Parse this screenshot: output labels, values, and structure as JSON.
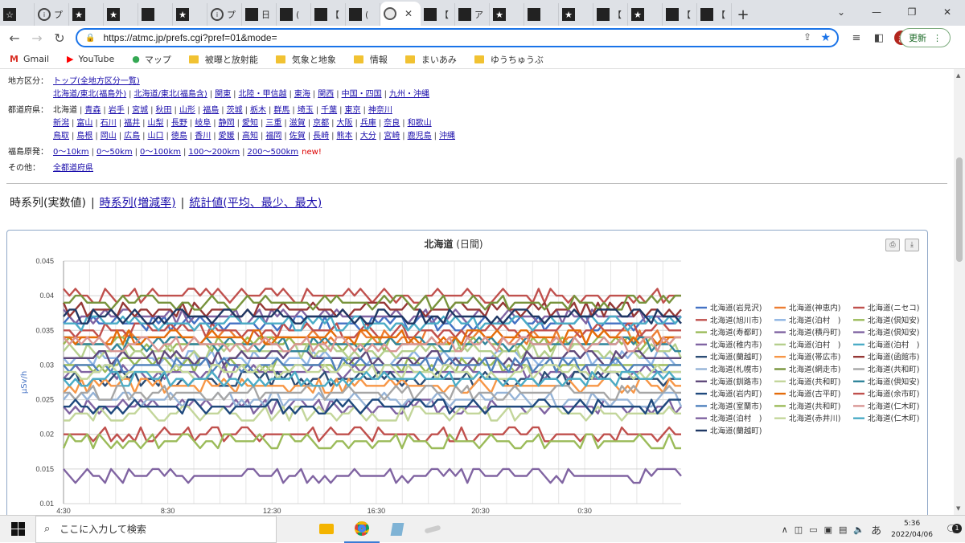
{
  "browser": {
    "tabs": [
      {
        "title": "",
        "icon": "clip-icon",
        "glyph": "☆",
        "fav": "blk"
      },
      {
        "title": "プ",
        "icon": "info-icon",
        "glyph": "i",
        "fav": "ring"
      },
      {
        "title": "",
        "icon": "clip-icon",
        "glyph": "★",
        "fav": "blk"
      },
      {
        "title": "",
        "icon": "clip-icon",
        "glyph": "★",
        "fav": "blk"
      },
      {
        "title": "",
        "icon": "clip-icon",
        "glyph": "",
        "fav": "blk"
      },
      {
        "title": "",
        "icon": "clip-icon",
        "glyph": "★",
        "fav": "blk"
      },
      {
        "title": "プ",
        "icon": "info-icon",
        "glyph": "i",
        "fav": "ring"
      },
      {
        "title": "日",
        "icon": "clip-icon",
        "glyph": "",
        "fav": "blk"
      },
      {
        "title": "(",
        "icon": "clip-icon",
        "glyph": "",
        "fav": "blk"
      },
      {
        "title": "【",
        "icon": "clip-icon",
        "glyph": "",
        "fav": "blk"
      },
      {
        "title": "(",
        "icon": "clip-icon",
        "glyph": "",
        "fav": "blk"
      }
    ],
    "active_tab": {
      "icon": "globe-icon",
      "close": "✕"
    },
    "tabs_after": [
      {
        "title": "【",
        "icon": "clip-icon",
        "glyph": "",
        "fav": "blk"
      },
      {
        "title": "ア",
        "icon": "clip-icon",
        "glyph": "",
        "fav": "blk"
      },
      {
        "title": "",
        "icon": "clip-icon",
        "glyph": "★",
        "fav": "blk"
      },
      {
        "title": "",
        "icon": "clip-icon",
        "glyph": "",
        "fav": "blk"
      },
      {
        "title": "",
        "icon": "clip-icon",
        "glyph": "★",
        "fav": "blk"
      },
      {
        "title": "【",
        "icon": "clip-icon",
        "glyph": "",
        "fav": "blk"
      },
      {
        "title": "",
        "icon": "clip-icon",
        "glyph": "★",
        "fav": "blk"
      },
      {
        "title": "【",
        "icon": "clip-icon",
        "glyph": "",
        "fav": "blk"
      },
      {
        "title": "【",
        "icon": "clip-icon",
        "glyph": "",
        "fav": "blk"
      }
    ],
    "new_tab": "+",
    "url": "https://atmc.jp/prefs.cgi?pref=01&mode=",
    "update_label": "更新",
    "avatar_letter": "ま",
    "bookmarks": [
      {
        "label": "Gmail",
        "icon": "gmail-icon",
        "glyph": "M",
        "color": "#d93025"
      },
      {
        "label": "YouTube",
        "icon": "youtube-icon",
        "glyph": "▶",
        "color": "#ff0000"
      },
      {
        "label": "マップ",
        "icon": "maps-icon",
        "glyph": "●",
        "color": "#34a853"
      },
      {
        "label": "被曝と放射能",
        "icon": "folder-icon"
      },
      {
        "label": "気象と地象",
        "icon": "folder-icon"
      },
      {
        "label": "情報",
        "icon": "folder-icon"
      },
      {
        "label": "まいあみ",
        "icon": "folder-icon"
      },
      {
        "label": "ゆうちゅうぶ",
        "icon": "folder-icon"
      }
    ]
  },
  "page": {
    "region": {
      "label": "地方区分：",
      "row1": [
        "トップ(全地方区分一覧)"
      ],
      "row2": [
        "北海道/東北(福島外)",
        "北海道/東北(福島含)",
        "関東",
        "北陸・甲信越",
        "東海",
        "関西",
        "中国・四国",
        "九州・沖縄"
      ]
    },
    "prefs": {
      "label": "都道府県：",
      "current": "北海道",
      "row1": [
        "青森",
        "岩手",
        "宮城",
        "秋田",
        "山形",
        "福島",
        "茨城",
        "栃木",
        "群馬",
        "埼玉",
        "千葉",
        "東京",
        "神奈川"
      ],
      "row2": [
        "新潟",
        "富山",
        "石川",
        "福井",
        "山梨",
        "長野",
        "岐阜",
        "静岡",
        "愛知",
        "三重",
        "滋賀",
        "京都",
        "大阪",
        "兵庫",
        "奈良",
        "和歌山"
      ],
      "row3": [
        "鳥取",
        "島根",
        "岡山",
        "広島",
        "山口",
        "徳島",
        "香川",
        "愛媛",
        "高知",
        "福岡",
        "佐賀",
        "長崎",
        "熊本",
        "大分",
        "宮崎",
        "鹿児島",
        "沖縄"
      ]
    },
    "fukushima": {
      "label": "福島原発：",
      "links": [
        "0〜10km",
        "0〜50km",
        "0〜100km",
        "100〜200km",
        "200〜500km"
      ],
      "new": "new!"
    },
    "other": {
      "label": "その他：",
      "links": [
        "全都道府県"
      ]
    },
    "views": {
      "current": "時系列(実数値)",
      "links": [
        "時系列(増減率)",
        "統計値(平均、最少、最大)"
      ],
      "sep": "|"
    }
  },
  "chart_data": {
    "type": "line",
    "title": "北海道",
    "subtitle": "(日間)",
    "ylabel": "μSv/h",
    "ylim": [
      0.01,
      0.045
    ],
    "yticks": [
      0.01,
      0.015,
      0.02,
      0.025,
      0.03,
      0.035,
      0.04,
      0.045
    ],
    "ytick_labels": [
      "0.01",
      "0.015",
      "0.02",
      "0.025",
      "0.03",
      "0.035",
      "0.04",
      "0.045"
    ],
    "xticks": [
      "4:30",
      "8:30",
      "12:30",
      "16:30",
      "20:30",
      "0:30"
    ],
    "xtick_hours": [
      4.5,
      8.5,
      12.5,
      16.5,
      20.5,
      24.5
    ],
    "x_range_hours": [
      4.5,
      28.2
    ],
    "series": [
      {
        "name": "北海道(岩見沢)",
        "color": "#4472c4",
        "base": 0.036
      },
      {
        "name": "北海道(神恵内)",
        "color": "#ed7d31",
        "base": 0.034
      },
      {
        "name": "北海道(ニセコ)",
        "color": "#c0504d",
        "base": 0.04
      },
      {
        "name": "北海道(旭川市)",
        "color": "#c0504d",
        "base": 0.035
      },
      {
        "name": "北海道(泊村　)",
        "color": "#8eb4e3",
        "base": 0.031
      },
      {
        "name": "北海道(倶知安)",
        "color": "#9bbb59",
        "base": 0.033
      },
      {
        "name": "北海道(寿都町)",
        "color": "#9bbb59",
        "base": 0.03
      },
      {
        "name": "北海道(積丹町)",
        "color": "#8064a2",
        "base": 0.029
      },
      {
        "name": "北海道(倶知安)",
        "color": "#8064a2",
        "base": 0.037
      },
      {
        "name": "北海道(稚内市)",
        "color": "#8064a2",
        "base": 0.024
      },
      {
        "name": "北海道(泊村　)",
        "color": "#b5cf8d",
        "base": 0.032
      },
      {
        "name": "北海道(泊村　)",
        "color": "#4bacc6",
        "base": 0.036
      },
      {
        "name": "北海道(蘭越町)",
        "color": "#2c4d75",
        "base": 0.028
      },
      {
        "name": "北海道(帯広市)",
        "color": "#f79646",
        "base": 0.027
      },
      {
        "name": "北海道(函館市)",
        "color": "#953735",
        "base": 0.038
      },
      {
        "name": "北海道(札幌市)",
        "color": "#95b3d7",
        "base": 0.025
      },
      {
        "name": "北海道(網走市)",
        "color": "#77933c",
        "base": 0.039
      },
      {
        "name": "北海道(共和町)",
        "color": "#a6a6a6",
        "base": 0.026
      },
      {
        "name": "北海道(釧路市)",
        "color": "#604a7b",
        "base": 0.031
      },
      {
        "name": "北海道(共和町)",
        "color": "#c3d69b",
        "base": 0.023
      },
      {
        "name": "北海道(倶知安)",
        "color": "#31859b",
        "base": 0.033
      },
      {
        "name": "北海道(岩内町)",
        "color": "#1f497d",
        "base": 0.024
      },
      {
        "name": "北海道(古平町)",
        "color": "#e46c0a",
        "base": 0.034
      },
      {
        "name": "北海道(余市町)",
        "color": "#c0504d",
        "base": 0.02
      },
      {
        "name": "北海道(室蘭市)",
        "color": "#4f81bd",
        "base": 0.03
      },
      {
        "name": "北海道(共和町)",
        "color": "#9bbb59",
        "base": 0.019
      },
      {
        "name": "北海道(仁木町)",
        "color": "#d99694",
        "base": 0.033
      },
      {
        "name": "北海道(泊村　)",
        "color": "#8064a2",
        "base": 0.014
      },
      {
        "name": "北海道(赤井川)",
        "color": "#c4d79b",
        "base": 0.029
      },
      {
        "name": "北海道(仁木町)",
        "color": "#4bacc6",
        "base": 0.028
      },
      {
        "name": "北海道(蘭越町)",
        "color": "#1f3864",
        "base": 0.037
      }
    ]
  },
  "taskbar": {
    "search_placeholder": "ここに入力して検索",
    "time": "5:36",
    "date": "2022/04/06",
    "ime": "あ",
    "notifications": "1"
  }
}
